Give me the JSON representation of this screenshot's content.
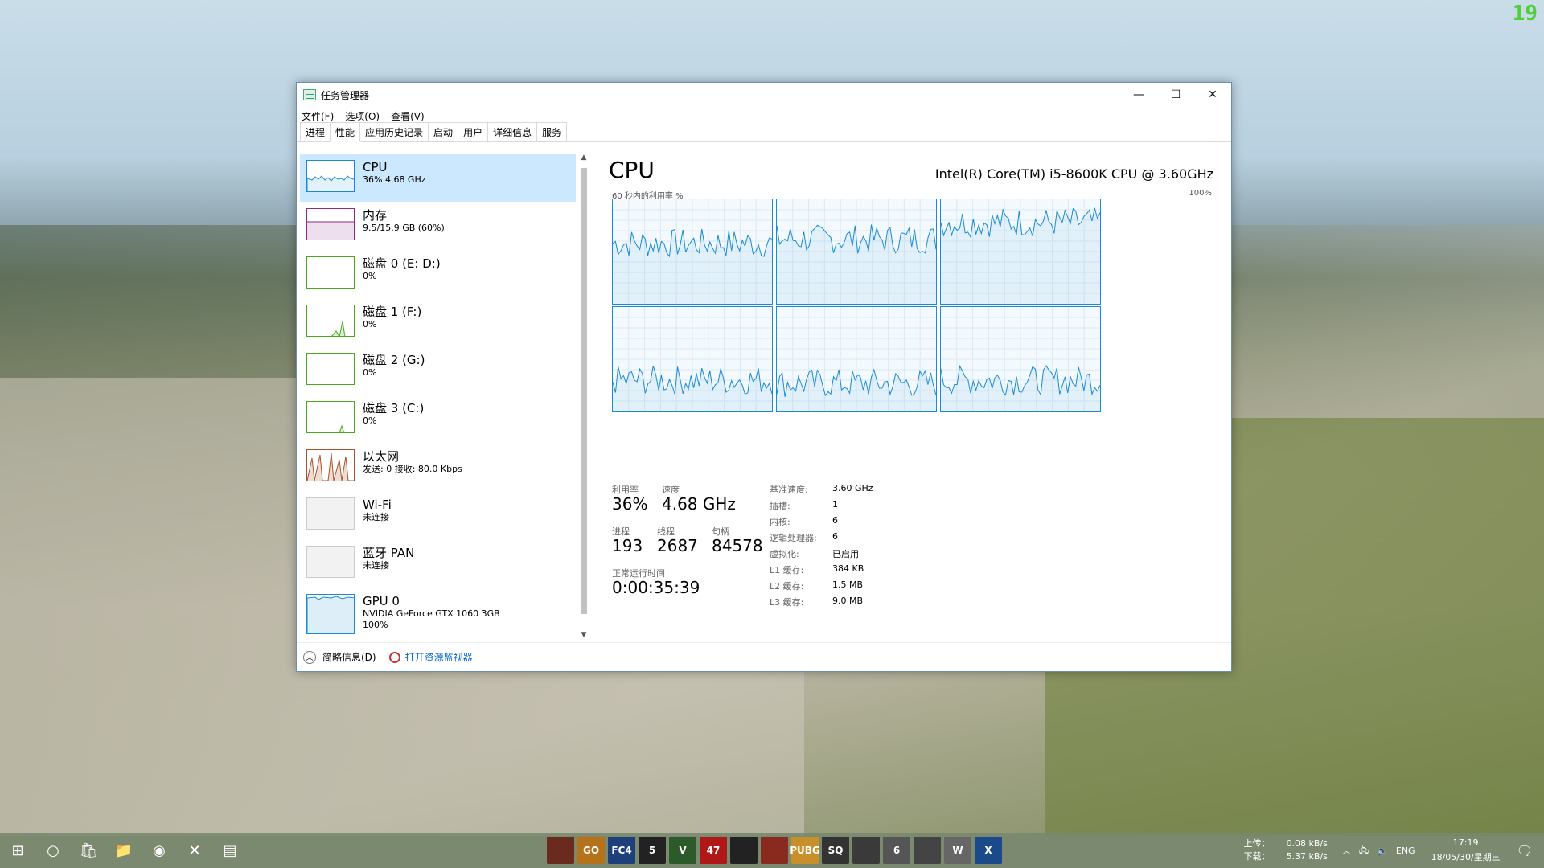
{
  "overlay": {
    "fps": "19"
  },
  "window": {
    "title": "任务管理器",
    "controls": {
      "minimize": "—",
      "maximize": "☐",
      "close": "✕"
    },
    "menu": [
      "文件(F)",
      "选项(O)",
      "查看(V)"
    ],
    "tabs": [
      "进程",
      "性能",
      "应用历史记录",
      "启动",
      "用户",
      "详细信息",
      "服务"
    ],
    "active_tab": "性能"
  },
  "sidebar": {
    "items": [
      {
        "name": "CPU",
        "sub": "36% 4.68 GHz",
        "sub2": "",
        "color": "#1a8bd1"
      },
      {
        "name": "内存",
        "sub": "9.5/15.9 GB (60%)",
        "sub2": "",
        "color": "#8b2a8b"
      },
      {
        "name": "磁盘 0 (E: D:)",
        "sub": "0%",
        "sub2": "",
        "color": "#4aa81c"
      },
      {
        "name": "磁盘 1 (F:)",
        "sub": "0%",
        "sub2": "",
        "color": "#4aa81c"
      },
      {
        "name": "磁盘 2 (G:)",
        "sub": "0%",
        "sub2": "",
        "color": "#4aa81c"
      },
      {
        "name": "磁盘 3 (C:)",
        "sub": "0%",
        "sub2": "",
        "color": "#4aa81c"
      },
      {
        "name": "以太网",
        "sub": "发送: 0 接收: 80.0 Kbps",
        "sub2": "",
        "color": "#a7542c"
      },
      {
        "name": "Wi-Fi",
        "sub": "未连接",
        "sub2": "",
        "color": "#bbbbbb"
      },
      {
        "name": "蓝牙 PAN",
        "sub": "未连接",
        "sub2": "",
        "color": "#bbbbbb"
      },
      {
        "name": "GPU 0",
        "sub": "NVIDIA GeForce GTX 1060 3GB",
        "sub2": "100%",
        "color": "#1a8bd1"
      }
    ]
  },
  "main": {
    "title": "CPU",
    "model": "Intel(R) Core(TM) i5-8600K CPU @ 3.60GHz",
    "graph_label": "60 秒内的利用率 %",
    "graph_max": "100%",
    "stats": {
      "util_label": "利用率",
      "util_value": "36%",
      "speed_label": "速度",
      "speed_value": "4.68 GHz",
      "proc_label": "进程",
      "proc_value": "193",
      "threads_label": "线程",
      "threads_value": "2687",
      "handles_label": "句柄",
      "handles_value": "84578",
      "uptime_label": "正常运行时间",
      "uptime_value": "0:00:35:39"
    },
    "specs": [
      {
        "label": "基准速度:",
        "value": "3.60 GHz"
      },
      {
        "label": "插槽:",
        "value": "1"
      },
      {
        "label": "内核:",
        "value": "6"
      },
      {
        "label": "逻辑处理器:",
        "value": "6"
      },
      {
        "label": "虚拟化:",
        "value": "已启用"
      },
      {
        "label": "L1 缓存:",
        "value": "384 KB"
      },
      {
        "label": "L2 缓存:",
        "value": "1.5 MB"
      },
      {
        "label": "L3 缓存:",
        "value": "9.0 MB"
      }
    ]
  },
  "bottom": {
    "fewer_details": "简略信息(D)",
    "open_monitor": "打开资源监视器"
  },
  "taskbar": {
    "games": [
      "",
      "GO",
      "FC4",
      "5",
      "V",
      "47",
      "",
      "",
      "PUBG",
      "SQ",
      "",
      "6",
      "",
      "W",
      "X"
    ],
    "net_up_label": "上传：",
    "net_up_value": "0.08 kB/s",
    "net_down_label": "下载：",
    "net_down_value": "5.37 kB/s",
    "lang": "ENG",
    "time": "17:19",
    "date": "18/05/30/星期三"
  }
}
